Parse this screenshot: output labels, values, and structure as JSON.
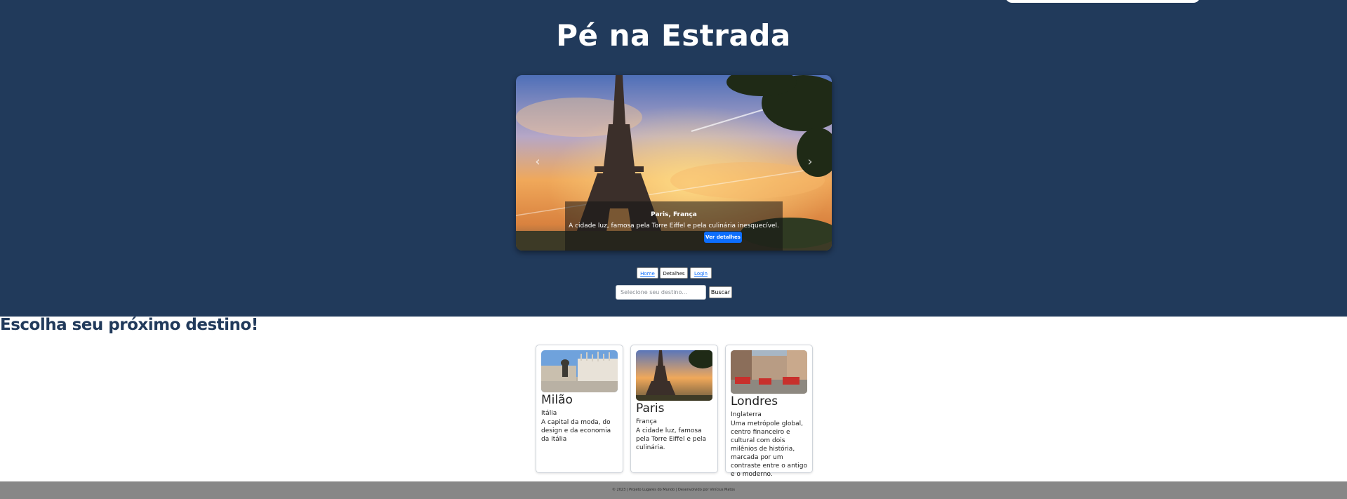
{
  "header": {
    "title": "Pé na Estrada"
  },
  "carousel": {
    "slide": {
      "title": "Paris, França",
      "description": "A cidade luz, famosa pela Torre Eiffel e pela culinária inesquecível.",
      "button_label": "Ver detalhes"
    },
    "prev_icon": "chevron-left-icon",
    "next_icon": "chevron-right-icon"
  },
  "nav": {
    "items": [
      {
        "label": "Home"
      },
      {
        "label": "Detalhes"
      },
      {
        "label": "Login"
      }
    ]
  },
  "search": {
    "placeholder": "Selecione seu destino...",
    "value": "",
    "button_label": "Buscar"
  },
  "destinations": {
    "heading": "Escolha seu próximo destino!",
    "cards": [
      {
        "title": "Milão",
        "country": "Itália",
        "description": "A capital da moda, do design e da economia da Itália"
      },
      {
        "title": "Paris",
        "country": "França",
        "description": "A cidade luz, famosa pela Torre Eiffel e pela culinária."
      },
      {
        "title": "Londres",
        "country": "Inglaterra",
        "description": "Uma metrópole global, centro financeiro e cultural com dois milênios de história, marcada por um contraste entre o antigo e o moderno."
      }
    ]
  },
  "footer": {
    "text": "© 2023 | Projeto Lugares do Mundo | Desenvolvido por Vinícius Matos"
  },
  "colors": {
    "hero_background": "#213a5b",
    "accent": "#0d6efd",
    "footer_background": "#878787"
  }
}
